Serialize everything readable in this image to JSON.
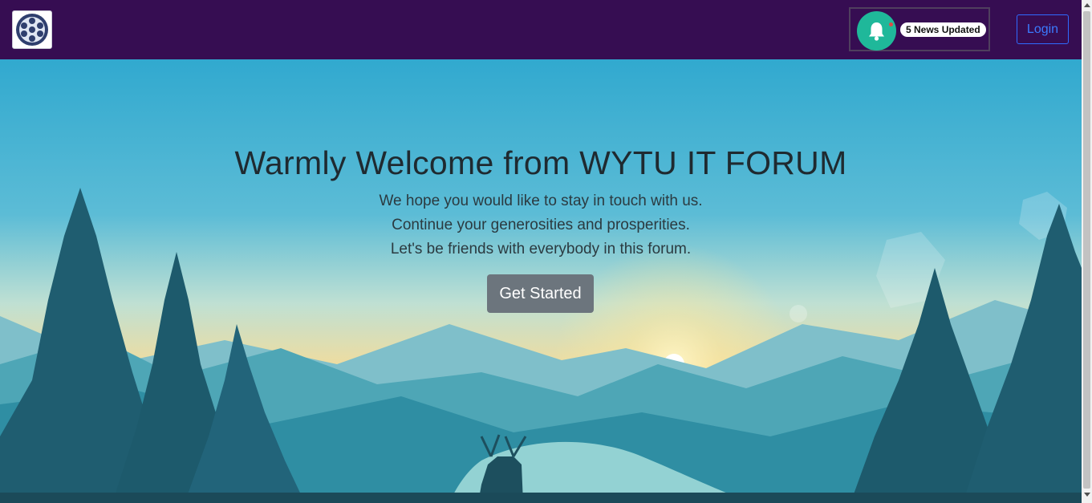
{
  "navbar": {
    "logo_icon": "film-reel-logo-icon",
    "notification": {
      "icon": "bell-icon",
      "badge_text": "5 News Updated"
    },
    "login_label": "Login"
  },
  "hero": {
    "title": "Warmly Welcome from WYTU IT FORUM",
    "lines": [
      "We hope you would like to stay in touch with us.",
      "Continue your generosities and prosperities.",
      "Let's be friends with everybody in this forum."
    ],
    "cta_label": "Get Started"
  },
  "colors": {
    "navbar_bg": "#360d52",
    "bell_bg": "#1fb89a",
    "login_border": "#2f6bff",
    "cta_bg": "#6c757d"
  }
}
